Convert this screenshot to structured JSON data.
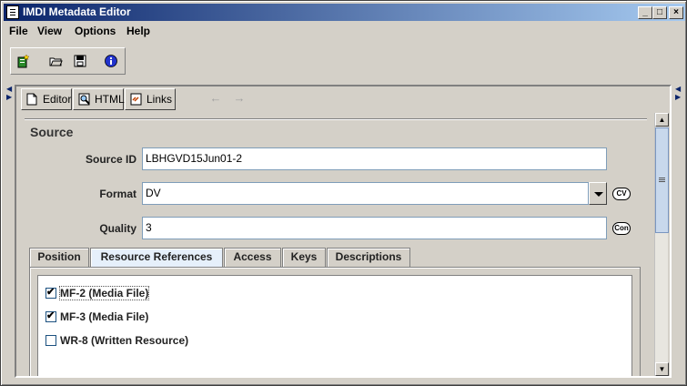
{
  "window": {
    "title": "IMDI Metadata Editor"
  },
  "menu": {
    "items": [
      {
        "label": "File"
      },
      {
        "label": "View"
      },
      {
        "label": "Options"
      },
      {
        "label": "Help"
      }
    ]
  },
  "toolbar": {
    "icons": [
      "new-icon",
      "open-icon",
      "save-icon",
      "info-icon"
    ]
  },
  "editor_tabs": [
    {
      "label": "Editor"
    },
    {
      "label": "HTML"
    },
    {
      "label": "Links"
    }
  ],
  "section": {
    "title": "Source"
  },
  "fields": {
    "source_id": {
      "label": "Source ID",
      "value": "LBHGVD15Jun01-2"
    },
    "format": {
      "label": "Format",
      "value": "DV",
      "badge": "CV"
    },
    "quality": {
      "label": "Quality",
      "value": "3",
      "badge": "Con"
    }
  },
  "tabs": [
    {
      "label": "Position"
    },
    {
      "label": "Resource References",
      "active": true
    },
    {
      "label": "Access"
    },
    {
      "label": "Keys"
    },
    {
      "label": "Descriptions"
    }
  ],
  "resource_references": [
    {
      "label": "MF-2 (Media File)",
      "checked": true
    },
    {
      "label": "MF-3 (Media File)",
      "checked": true
    },
    {
      "label": "WR-8 (Written Resource)",
      "checked": false
    }
  ],
  "colors": {
    "title_start": "#0a246a",
    "title_end": "#a6caf0",
    "active_tab": "#e6f0fb"
  }
}
